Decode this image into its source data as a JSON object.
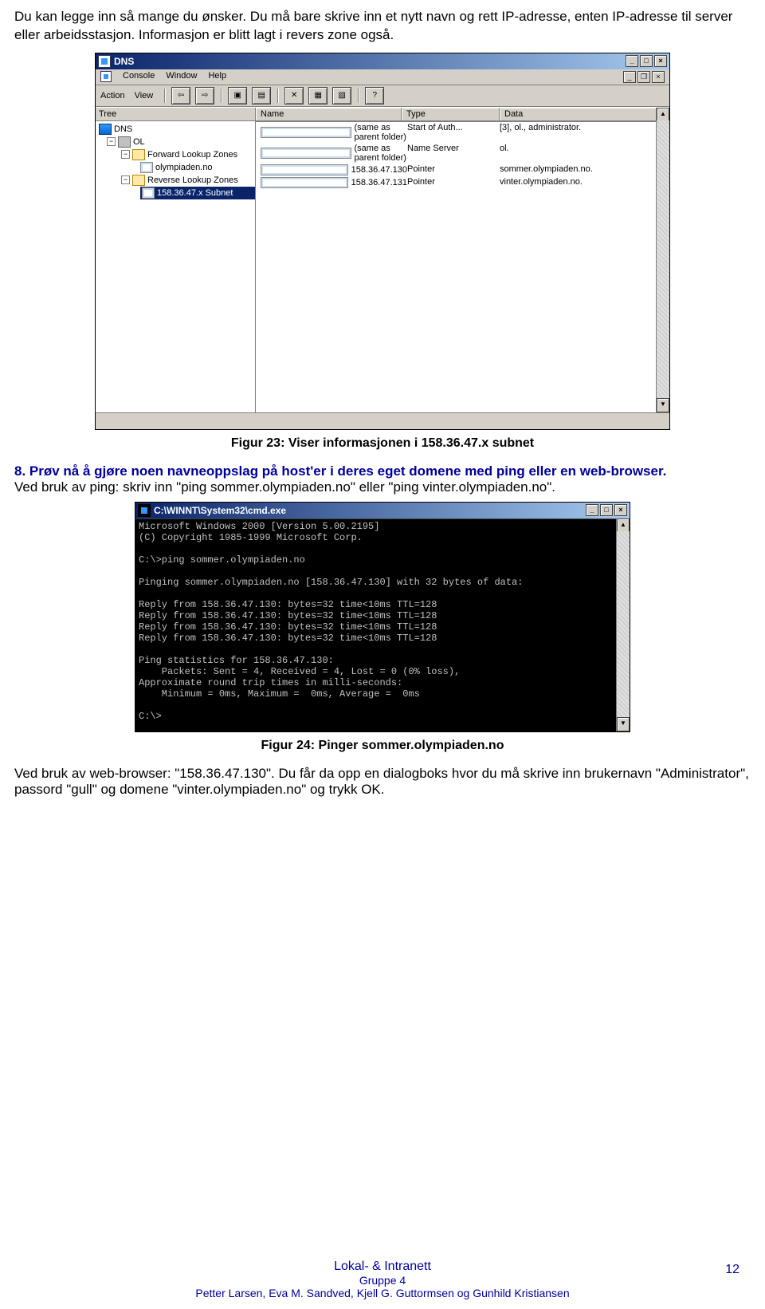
{
  "paragraphs": {
    "intro": "Du kan legge inn så mange du ønsker. Du må bare skrive inn et nytt navn og rett IP-adresse, enten IP-adresse til server eller arbeidsstasjon. Informasjon er blitt lagt i revers zone også.",
    "step8_bold": "8. Prøv nå å gjøre noen navneoppslag på host'er i deres eget domene med ping eller en web-browser.",
    "step8_body": "Ved bruk av ping: skriv inn \"ping sommer.olympiaden.no\" eller \"ping vinter.olympiaden.no\".",
    "after_fig24": "Ved bruk av web-browser: \"158.36.47.130\". Du får da opp en dialogboks hvor du må skrive inn brukernavn \"Administrator\", passord \"gull\" og domene \"vinter.olympiaden.no\" og trykk OK."
  },
  "captions": {
    "fig23": "Figur 23: Viser informasjonen i 158.36.47.x subnet",
    "fig24": "Figur 24: Pinger sommer.olympiaden.no"
  },
  "dns": {
    "title": "DNS",
    "menu1": [
      "Console",
      "Window",
      "Help"
    ],
    "menu2_labels": {
      "action": "Action",
      "view": "View"
    },
    "tree_header": "Tree",
    "tree": {
      "root": "DNS",
      "server": "OL",
      "fwd": "Forward Lookup Zones",
      "fwd_child": "olympiaden.no",
      "rev": "Reverse Lookup Zones",
      "rev_child": "158.36.47.x Subnet"
    },
    "list_headers": {
      "name": "Name",
      "type": "Type",
      "data": "Data"
    },
    "rows": [
      {
        "name": "(same as parent folder)",
        "type": "Start of Auth...",
        "data": "[3], ol., administrator."
      },
      {
        "name": "(same as parent folder)",
        "type": "Name Server",
        "data": "ol."
      },
      {
        "name": "158.36.47.130",
        "type": "Pointer",
        "data": "sommer.olympiaden.no."
      },
      {
        "name": "158.36.47.131",
        "type": "Pointer",
        "data": "vinter.olympiaden.no."
      }
    ]
  },
  "cmd": {
    "title": "C:\\WINNT\\System32\\cmd.exe",
    "text": "Microsoft Windows 2000 [Version 5.00.2195]\n(C) Copyright 1985-1999 Microsoft Corp.\n\nC:\\>ping sommer.olympiaden.no\n\nPinging sommer.olympiaden.no [158.36.47.130] with 32 bytes of data:\n\nReply from 158.36.47.130: bytes=32 time<10ms TTL=128\nReply from 158.36.47.130: bytes=32 time<10ms TTL=128\nReply from 158.36.47.130: bytes=32 time<10ms TTL=128\nReply from 158.36.47.130: bytes=32 time<10ms TTL=128\n\nPing statistics for 158.36.47.130:\n    Packets: Sent = 4, Received = 4, Lost = 0 (0% loss),\nApproximate round trip times in milli-seconds:\n    Minimum = 0ms, Maximum =  0ms, Average =  0ms\n\nC:\\>"
  },
  "footer": {
    "line1": "Lokal- & Intranett",
    "line2": "Gruppe 4",
    "line3": "Petter Larsen, Eva M. Sandved, Kjell G. Guttormsen og Gunhild Kristiansen",
    "page": "12"
  }
}
